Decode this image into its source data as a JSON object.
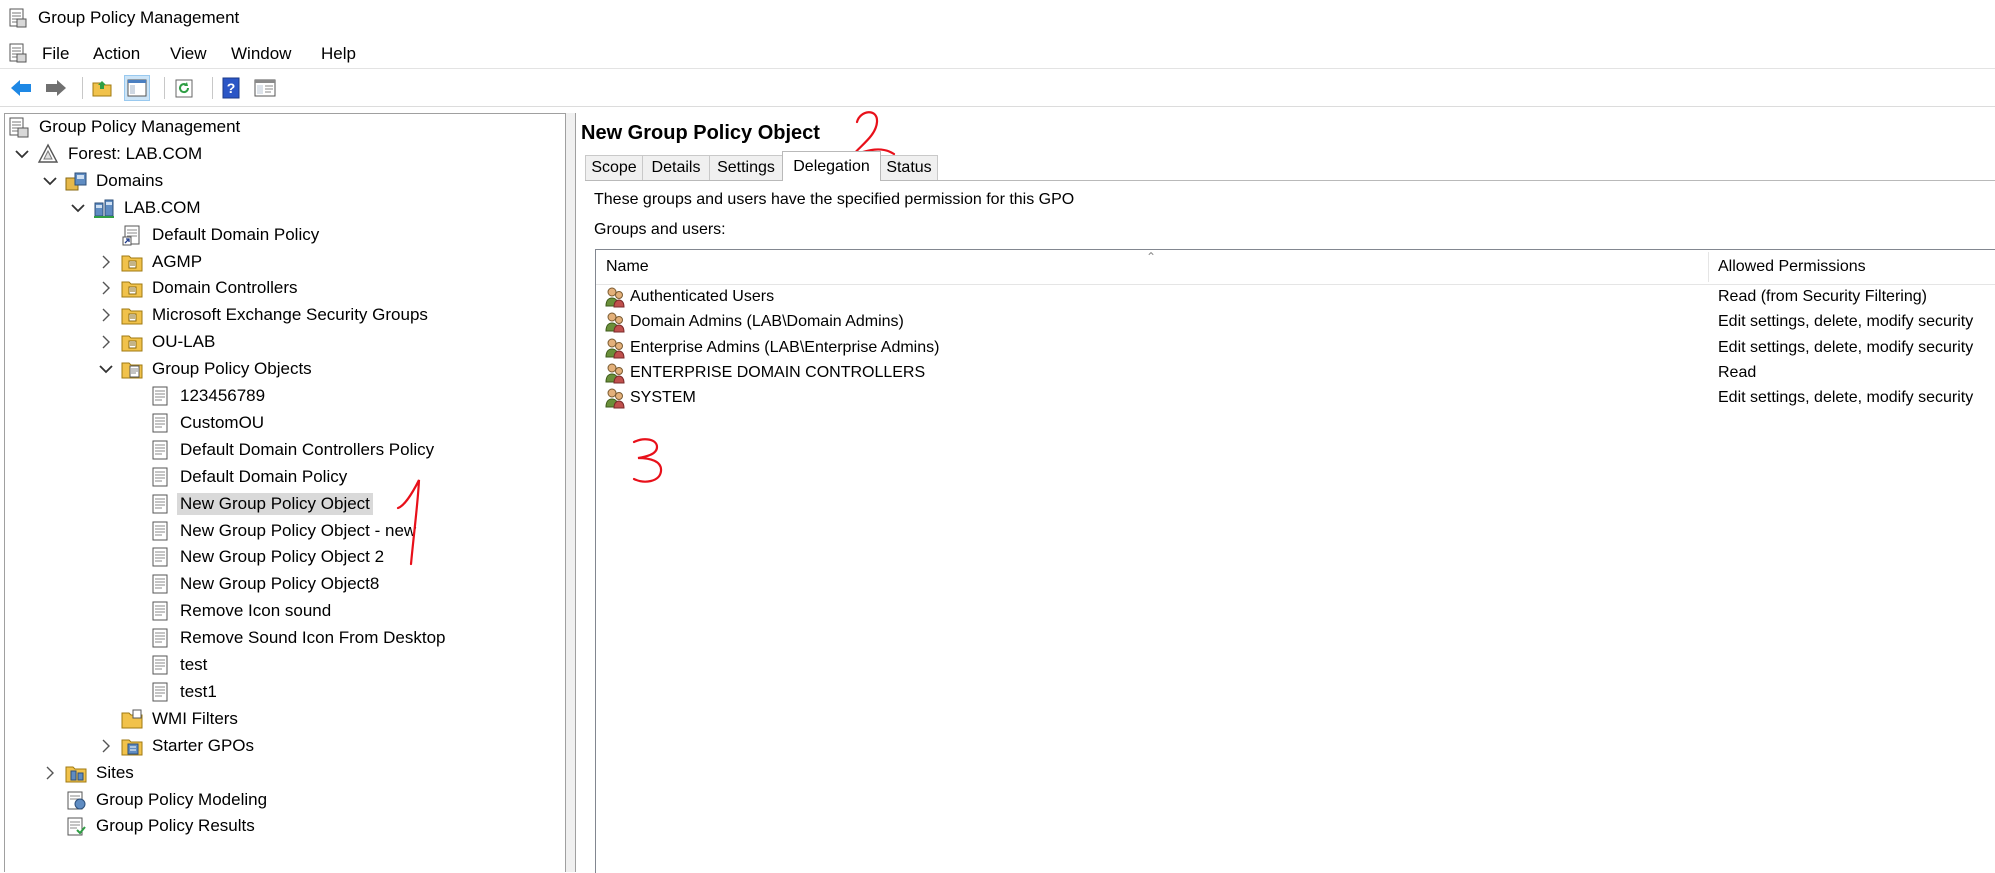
{
  "window": {
    "title": "Group Policy Management"
  },
  "menu": [
    "File",
    "Action",
    "View",
    "Window",
    "Help"
  ],
  "toolbar": {
    "buttons": [
      "back-icon",
      "forward-icon",
      "up-folder-icon",
      "show-hide-tree-icon",
      "refresh-icon",
      "help-icon",
      "properties-icon"
    ]
  },
  "tree": [
    {
      "label": "Group Policy Management",
      "icon": "gpm-console-icon",
      "expander": ""
    },
    {
      "label": "Forest: LAB.COM",
      "icon": "forest-icon",
      "expander": "expanded"
    },
    {
      "label": "Domains",
      "icon": "domains-icon",
      "expander": "expanded"
    },
    {
      "label": "LAB.COM",
      "icon": "domain-icon",
      "expander": "expanded"
    },
    {
      "label": "Default Domain Policy",
      "icon": "gpo-link-icon",
      "expander": ""
    },
    {
      "label": "AGMP",
      "icon": "ou-folder-icon",
      "expander": "collapsed"
    },
    {
      "label": "Domain Controllers",
      "icon": "ou-folder-icon",
      "expander": "collapsed"
    },
    {
      "label": "Microsoft Exchange Security Groups",
      "icon": "ou-folder-icon",
      "expander": "collapsed"
    },
    {
      "label": "OU-LAB",
      "icon": "ou-folder-icon",
      "expander": "collapsed"
    },
    {
      "label": "Group Policy Objects",
      "icon": "gpo-container-icon",
      "expander": "expanded"
    },
    {
      "label": "123456789",
      "icon": "gpo-icon",
      "expander": ""
    },
    {
      "label": "CustomOU",
      "icon": "gpo-icon",
      "expander": ""
    },
    {
      "label": "Default Domain Controllers Policy",
      "icon": "gpo-icon",
      "expander": ""
    },
    {
      "label": "Default Domain Policy",
      "icon": "gpo-icon",
      "expander": ""
    },
    {
      "label": "New Group Policy Object",
      "icon": "gpo-icon",
      "expander": "",
      "selected": true
    },
    {
      "label": "New Group Policy Object - new",
      "icon": "gpo-icon",
      "expander": ""
    },
    {
      "label": "New Group Policy Object 2",
      "icon": "gpo-icon",
      "expander": ""
    },
    {
      "label": "New Group Policy Object8",
      "icon": "gpo-icon",
      "expander": ""
    },
    {
      "label": "Remove Icon sound",
      "icon": "gpo-icon",
      "expander": ""
    },
    {
      "label": "Remove Sound Icon From Desktop",
      "icon": "gpo-icon",
      "expander": ""
    },
    {
      "label": "test",
      "icon": "gpo-icon",
      "expander": ""
    },
    {
      "label": "test1",
      "icon": "gpo-icon",
      "expander": ""
    },
    {
      "label": "WMI Filters",
      "icon": "wmi-folder-icon",
      "expander": ""
    },
    {
      "label": "Starter GPOs",
      "icon": "starter-gpo-icon",
      "expander": "collapsed"
    },
    {
      "label": "Sites",
      "icon": "sites-icon",
      "expander": "collapsed"
    },
    {
      "label": "Group Policy Modeling",
      "icon": "modeling-icon",
      "expander": ""
    },
    {
      "label": "Group Policy Results",
      "icon": "results-icon",
      "expander": ""
    }
  ],
  "details": {
    "title": "New Group Policy Object",
    "tabs": [
      "Scope",
      "Details",
      "Settings",
      "Delegation",
      "Status"
    ],
    "active_tab": "Delegation",
    "description": "These groups and users have the specified permission for this GPO",
    "list_label": "Groups and users:",
    "columns": [
      "Name",
      "Allowed Permissions"
    ],
    "rows": [
      {
        "name": "Authenticated Users",
        "permission": "Read (from Security Filtering)"
      },
      {
        "name": "Domain Admins (LAB\\Domain Admins)",
        "permission": "Edit settings, delete, modify security"
      },
      {
        "name": "Enterprise Admins (LAB\\Enterprise Admins)",
        "permission": "Edit settings, delete, modify security"
      },
      {
        "name": "ENTERPRISE DOMAIN CONTROLLERS",
        "permission": "Read"
      },
      {
        "name": "SYSTEM",
        "permission": "Edit settings, delete, modify security"
      }
    ]
  },
  "annotations": [
    "1",
    "2",
    "3"
  ],
  "colors": {
    "selection": "#d9d9d9",
    "annotation": "#e8101a",
    "nav_arrow": "#1e88e5"
  }
}
